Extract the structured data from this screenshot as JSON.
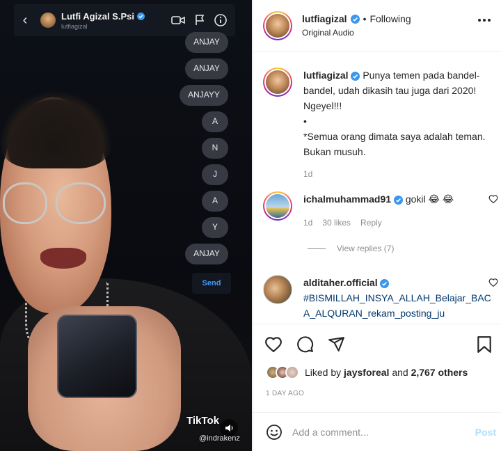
{
  "video": {
    "chat_header": {
      "name": "Lutfi Agizal S.Psi",
      "handle": "lutfiagizal"
    },
    "bubbles": [
      "ANJAY",
      "ANJAY",
      "ANJAYY",
      "A",
      "N",
      "J",
      "A",
      "Y",
      "ANJAY"
    ],
    "send_label": "Send",
    "tiktok_watermark": "TikTok",
    "tiktok_handle": "@indrakenz"
  },
  "post": {
    "username": "lutfiagizal",
    "separator": "•",
    "follow_status": "Following",
    "audio_label": "Original Audio",
    "caption": {
      "username": "lutfiagizal",
      "text": "Punya temen pada bandel-bandel, udah dikasih tau juga dari 2020! Ngeyel!!!",
      "bullet": "•",
      "quote": "*Semua orang dimata saya adalah teman. Bukan musuh.",
      "age": "1d"
    },
    "comments": [
      {
        "username": "ichalmuhammad91",
        "text": "gokil 😂 😂",
        "age": "1d",
        "likes": "30 likes",
        "reply_label": "Reply",
        "view_replies": "View replies (7)"
      },
      {
        "username": "alditaher.official",
        "text": "#BISMILLAH_INSYA_ALLAH_Belajar_BACA_ALQURAN_rekam_posting_ju"
      }
    ],
    "liked_by": {
      "prefix": "Liked by",
      "user": "jaysforeal",
      "middle": "and",
      "others": "2,767 others"
    },
    "timestamp": "1 DAY AGO",
    "comment_placeholder": "Add a comment...",
    "post_label": "Post",
    "colors": {
      "verified": "#3897f0",
      "link": "#00376b",
      "muted": "#8e8e8e",
      "post_button_disabled": "#b2dffc"
    }
  }
}
